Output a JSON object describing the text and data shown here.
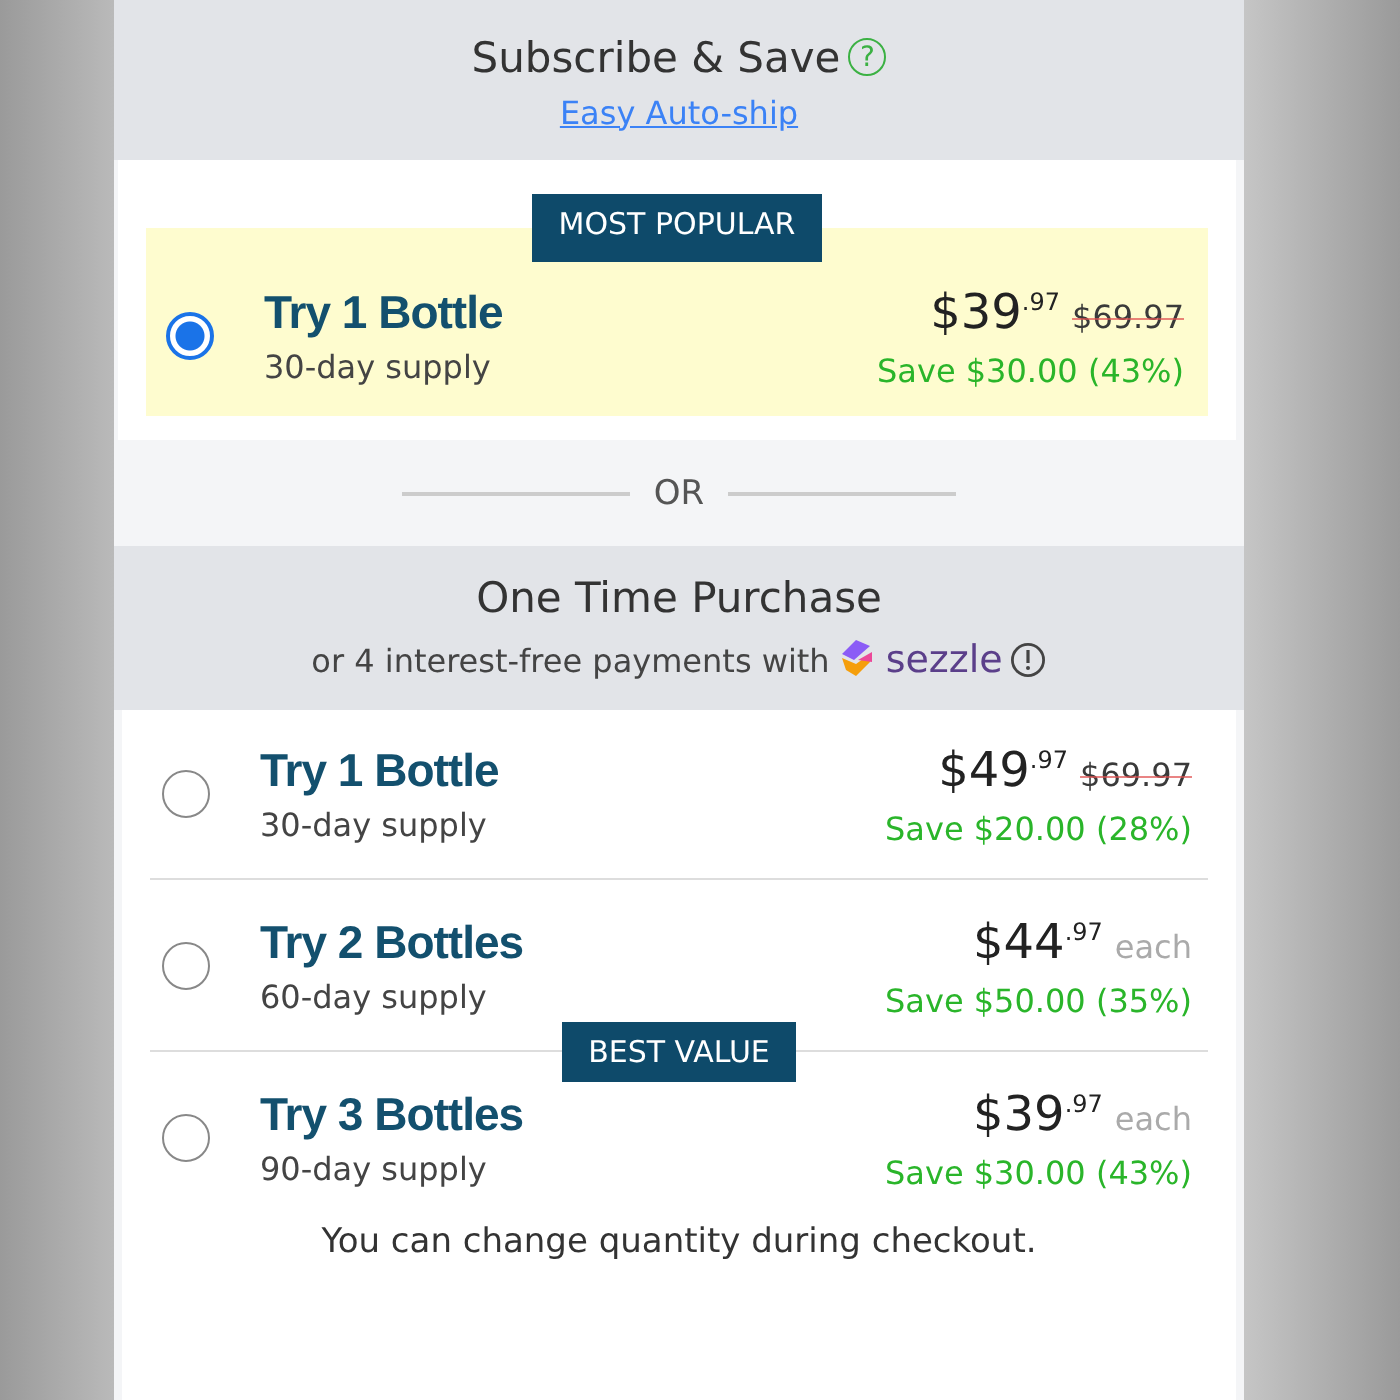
{
  "subscribe": {
    "title": "Subscribe & Save",
    "help_icon": "?",
    "link": "Easy Auto-ship",
    "options": [
      {
        "badge": "MOST POPULAR",
        "title": "Try 1 Bottle",
        "supply": "30-day supply",
        "selected": true,
        "price": "$39",
        "cents": ".97",
        "old_price": "$69.97",
        "save": "Save $30.00 (43%)"
      }
    ]
  },
  "separator": "OR",
  "one_time": {
    "title": "One Time Purchase",
    "note": "or 4 interest-free payments with",
    "brand": "sezzle",
    "options": [
      {
        "title": "Try 1 Bottle",
        "supply": "30-day supply",
        "selected": false,
        "price": "$49",
        "cents": ".97",
        "old_price": "$69.97",
        "save": "Save $20.00 (28%)"
      },
      {
        "title": "Try 2 Bottles",
        "supply": "60-day supply",
        "selected": false,
        "price": "$44",
        "cents": ".97",
        "unit": "each",
        "save": "Save $50.00 (35%)"
      },
      {
        "badge": "BEST VALUE",
        "title": "Try 3 Bottles",
        "supply": "90-day supply",
        "selected": false,
        "price": "$39",
        "cents": ".97",
        "unit": "each",
        "save": "Save $30.00 (43%)"
      }
    ],
    "footnote": "You can change quantity during checkout."
  }
}
